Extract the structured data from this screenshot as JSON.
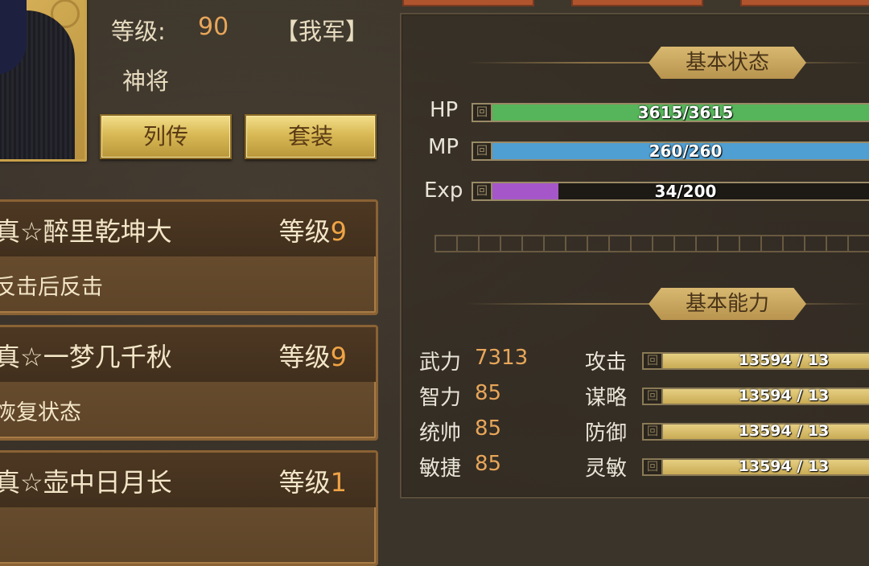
{
  "hero": {
    "level_label": "等级:",
    "level_value": "90",
    "faction": "【我军】",
    "rank": "神将",
    "buttons": {
      "biography": "列传",
      "outfit": "套装"
    }
  },
  "skills": [
    {
      "name": "真☆醉里乾坤大",
      "level_label": "等级",
      "level_value": "9",
      "desc": "反击后反击"
    },
    {
      "name": "真☆一梦几千秋",
      "level_label": "等级",
      "level_value": "9",
      "desc": "恢复状态"
    },
    {
      "name": "真☆壶中日月长",
      "level_label": "等级",
      "level_value": "1",
      "desc": ""
    }
  ],
  "basic_status": {
    "header": "基本状态",
    "bars": [
      {
        "label": "HP",
        "text": "3615/3615",
        "fill": 1.0,
        "color": "#56b55a"
      },
      {
        "label": "MP",
        "text": "260/260",
        "fill": 1.0,
        "color": "#4f9fd3"
      },
      {
        "label": "Exp",
        "text": "34/200",
        "fill": 0.17,
        "color": "#a557c9"
      }
    ]
  },
  "basic_ability": {
    "header": "基本能力",
    "stats": [
      {
        "label": "武力",
        "value": "7313"
      },
      {
        "label": "智力",
        "value": "85"
      },
      {
        "label": "统帅",
        "value": "85"
      },
      {
        "label": "敏捷",
        "value": "85"
      }
    ],
    "bars": [
      {
        "label": "攻击",
        "text": "13594 / 13",
        "fill": 1.0
      },
      {
        "label": "谋略",
        "text": "13594 / 13",
        "fill": 1.0
      },
      {
        "label": "防御",
        "text": "13594 / 13",
        "fill": 1.0
      },
      {
        "label": "灵敏",
        "text": "13594 / 13",
        "fill": 1.0
      }
    ]
  }
}
